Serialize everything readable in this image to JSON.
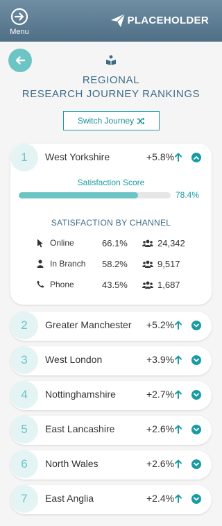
{
  "header": {
    "menu_label": "Menu",
    "brand": "PLACEHOLDER"
  },
  "page": {
    "title_line1": "REGIONAL",
    "title_line2": "RESEARCH JOURNEY RANKINGS",
    "switch_label": "Switch Journey"
  },
  "colors": {
    "accent": "#1a9ba3",
    "accent_light": "#6cc5c4",
    "title": "#3d6b87",
    "header_bg": "#5b7b91"
  },
  "expanded": {
    "satisfaction_label": "Satisfaction Score",
    "satisfaction_value": "78.4%",
    "satisfaction_fraction": 0.784,
    "channels_heading": "SATISFACTION BY CHANNEL",
    "channels": [
      {
        "icon": "cursor-icon",
        "name": "Online",
        "pct": "66.1%",
        "count": "24,342"
      },
      {
        "icon": "person-icon",
        "name": "In Branch",
        "pct": "58.2%",
        "count": "9,517"
      },
      {
        "icon": "phone-icon",
        "name": "Phone",
        "pct": "43.5%",
        "count": "1,687"
      }
    ]
  },
  "rankings": [
    {
      "rank": "1",
      "region": "West Yorkshire",
      "change": "+5.8%",
      "expanded": true
    },
    {
      "rank": "2",
      "region": "Greater Manchester",
      "change": "+5.2%",
      "expanded": false
    },
    {
      "rank": "3",
      "region": "West London",
      "change": "+3.9%",
      "expanded": false
    },
    {
      "rank": "4",
      "region": "Nottinghamshire",
      "change": "+2.7%",
      "expanded": false
    },
    {
      "rank": "5",
      "region": "East Lancashire",
      "change": "+2.6%",
      "expanded": false
    },
    {
      "rank": "6",
      "region": "North Wales",
      "change": "+2.6%",
      "expanded": false
    },
    {
      "rank": "7",
      "region": "East Anglia",
      "change": "+2.4%",
      "expanded": false
    }
  ]
}
